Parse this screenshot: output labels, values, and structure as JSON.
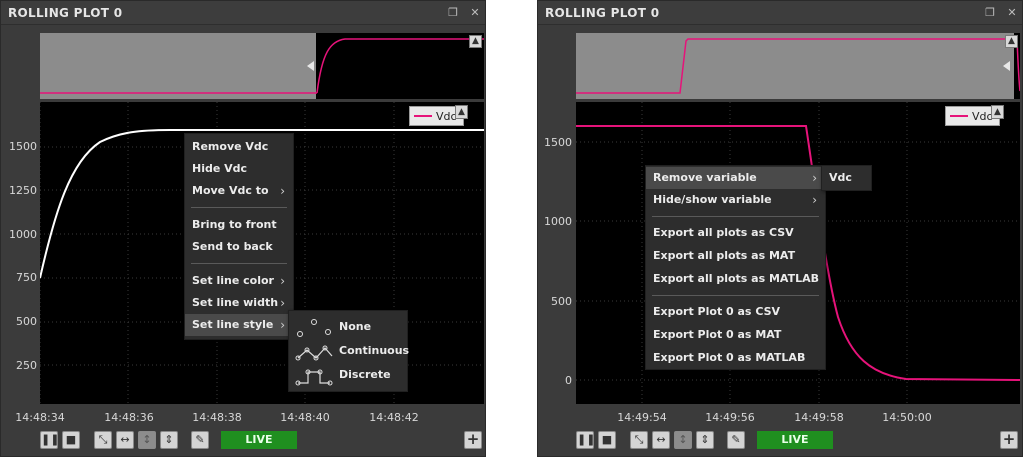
{
  "colors": {
    "trace": "#e6137a",
    "live": "#1f8f1f",
    "panel": "#3b3b3b"
  },
  "left_panel": {
    "title": "ROLLING PLOT 0",
    "legend": "Vdc",
    "yticks": [
      "1500",
      "1250",
      "1000",
      "750",
      "500",
      "250"
    ],
    "xticks": [
      "14:48:34",
      "14:48:36",
      "14:48:38",
      "14:48:40",
      "14:48:42"
    ],
    "live_label": "LIVE",
    "context_menu": {
      "remove": "Remove Vdc",
      "hide": "Hide Vdc",
      "move": "Move Vdc to",
      "bring_front": "Bring to front",
      "send_back": "Send to back",
      "line_color": "Set line color",
      "line_width": "Set line width",
      "line_style": "Set line style"
    },
    "style_submenu": {
      "none": "None",
      "continuous": "Continuous",
      "discrete": "Discrete"
    }
  },
  "right_panel": {
    "title": "ROLLING PLOT 0",
    "legend": "Vdc",
    "yticks": [
      "1500",
      "1000",
      "500",
      "0"
    ],
    "xticks": [
      "14:49:54",
      "14:49:56",
      "14:49:58",
      "14:50:00"
    ],
    "live_label": "LIVE",
    "context_menu": {
      "remove_var": "Remove variable",
      "hide_show": "Hide/show variable",
      "export_all_csv": "Export all plots as CSV",
      "export_all_mat": "Export all plots as MAT",
      "export_all_matlab": "Export all plots as MATLAB",
      "export_p0_csv": "Export Plot 0 as CSV",
      "export_p0_mat": "Export Plot 0 as MAT",
      "export_p0_matlab": "Export Plot 0 as MATLAB"
    },
    "remove_submenu": {
      "item": "Vdc"
    }
  },
  "icons": {
    "title_restore": "restore-window-icon",
    "title_close": "close-icon",
    "toolbar": [
      "pause-icon",
      "stop-icon",
      "autoscale-icon",
      "fit-horizontal-icon",
      "fit-vertical-icon",
      "fit-both-icon",
      "clear-brush-icon"
    ],
    "add": "plus-icon"
  }
}
